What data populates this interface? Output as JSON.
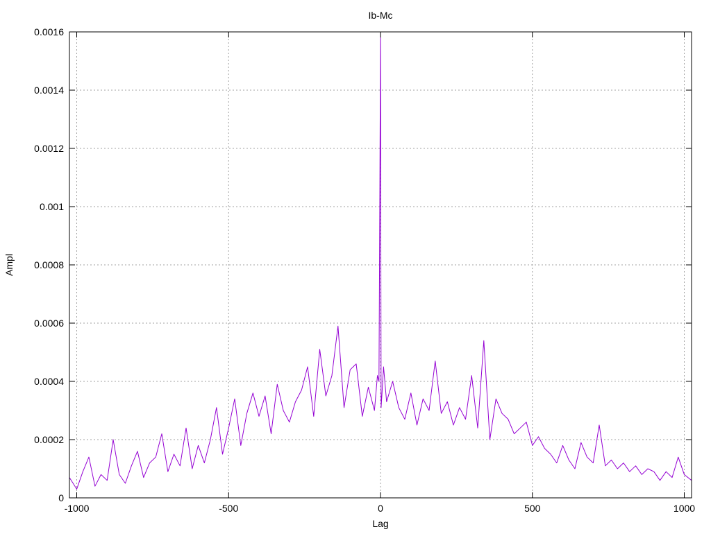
{
  "chart_data": {
    "type": "line",
    "title": "Ib-Mc",
    "xlabel": "Lag",
    "ylabel": "Ampl",
    "xlim": [
      -1024,
      1024
    ],
    "ylim": [
      0,
      0.0016
    ],
    "x_ticks": [
      -1000,
      -500,
      0,
      500,
      1000
    ],
    "x_tick_labels": [
      "-1000",
      "-500",
      "0",
      "500",
      "1000"
    ],
    "y_ticks": [
      0,
      0.0002,
      0.0004,
      0.0006,
      0.0008,
      0.001,
      0.0012,
      0.0014,
      0.0016
    ],
    "y_tick_labels": [
      "0",
      "0.0002",
      "0.0004",
      "0.0006",
      "0.0008",
      "0.001",
      "0.0012",
      "0.0014",
      "0.0016"
    ],
    "grid": true,
    "series_color": "#9400d3",
    "series": [
      {
        "x": [
          -1024,
          -1000,
          -980,
          -960,
          -940,
          -920,
          -900,
          -880,
          -860,
          -840,
          -820,
          -800,
          -780,
          -760,
          -740,
          -720,
          -700,
          -680,
          -660,
          -640,
          -620,
          -600,
          -580,
          -560,
          -540,
          -520,
          -500,
          -480,
          -460,
          -440,
          -420,
          -400,
          -380,
          -360,
          -340,
          -320,
          -300,
          -280,
          -260,
          -240,
          -220,
          -200,
          -180,
          -160,
          -140,
          -120,
          -100,
          -80,
          -60,
          -40,
          -20,
          -10,
          -5,
          -2,
          0,
          2,
          5,
          10,
          20,
          40,
          60,
          80,
          100,
          120,
          140,
          160,
          180,
          200,
          220,
          240,
          260,
          280,
          300,
          320,
          340,
          360,
          380,
          400,
          420,
          440,
          460,
          480,
          500,
          520,
          540,
          560,
          580,
          600,
          620,
          640,
          660,
          680,
          700,
          720,
          740,
          760,
          780,
          800,
          820,
          840,
          860,
          880,
          900,
          920,
          940,
          960,
          980,
          1000,
          1024
        ],
        "values": [
          7e-05,
          3e-05,
          9e-05,
          0.00014,
          4e-05,
          8e-05,
          6e-05,
          0.0002,
          8e-05,
          5e-05,
          0.00011,
          0.00016,
          7e-05,
          0.00012,
          0.00014,
          0.00022,
          9e-05,
          0.00015,
          0.00011,
          0.00024,
          0.0001,
          0.00018,
          0.00012,
          0.0002,
          0.00031,
          0.00015,
          0.00024,
          0.00034,
          0.00018,
          0.00029,
          0.00036,
          0.00028,
          0.00035,
          0.00022,
          0.00039,
          0.0003,
          0.00026,
          0.00033,
          0.00037,
          0.00045,
          0.00028,
          0.00051,
          0.00035,
          0.00042,
          0.00059,
          0.00031,
          0.00044,
          0.00046,
          0.00028,
          0.00038,
          0.0003,
          0.00042,
          0.0004,
          0.00107,
          0.0016,
          0.00031,
          0.00036,
          0.00045,
          0.00033,
          0.0004,
          0.00031,
          0.00027,
          0.00036,
          0.00025,
          0.00034,
          0.0003,
          0.00047,
          0.00029,
          0.00033,
          0.00025,
          0.00031,
          0.00027,
          0.00042,
          0.00024,
          0.00054,
          0.0002,
          0.00034,
          0.00029,
          0.00027,
          0.00022,
          0.00024,
          0.00026,
          0.00018,
          0.00021,
          0.00017,
          0.00015,
          0.00012,
          0.00018,
          0.00013,
          0.0001,
          0.00019,
          0.00014,
          0.00012,
          0.00025,
          0.00011,
          0.00013,
          0.0001,
          0.00012,
          9e-05,
          0.00011,
          8e-05,
          0.0001,
          9e-05,
          6e-05,
          9e-05,
          7e-05,
          0.00014,
          8e-05,
          6e-05
        ]
      }
    ]
  }
}
